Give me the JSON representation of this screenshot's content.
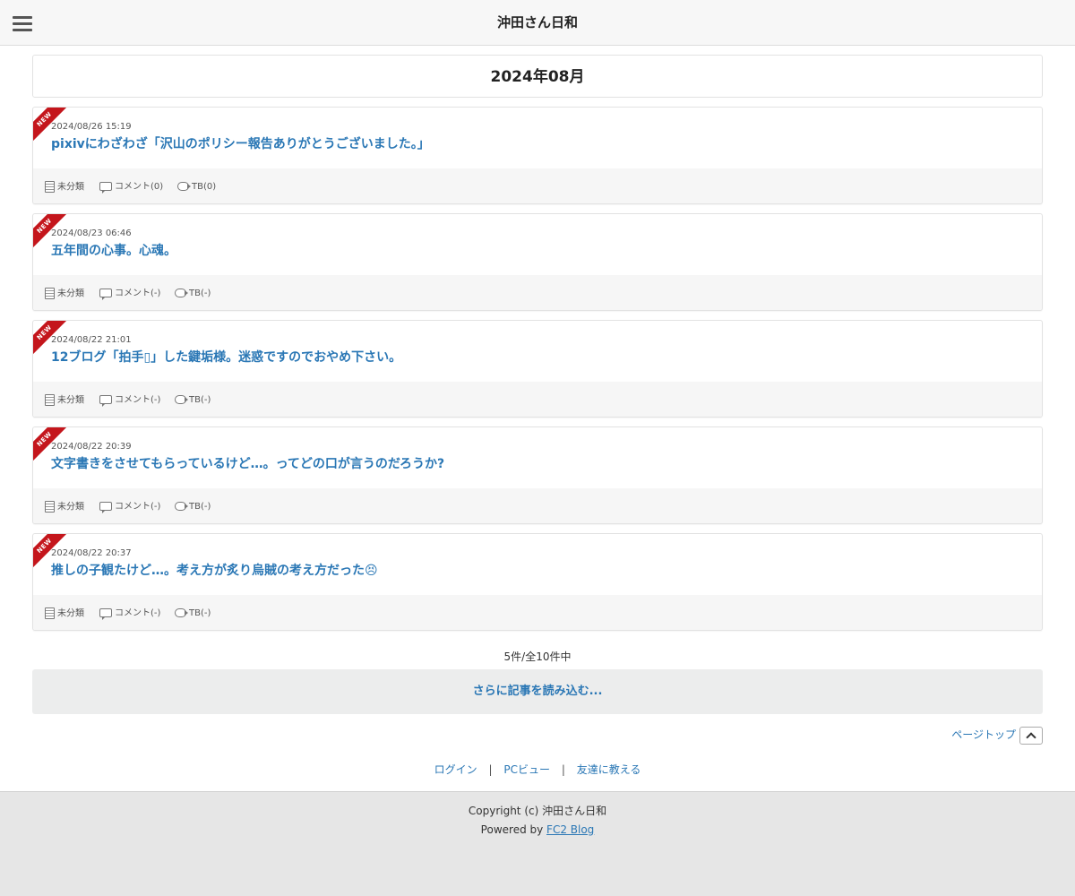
{
  "header": {
    "title": "沖田さん日和",
    "menu_icon": "hamburger-menu-icon"
  },
  "month": {
    "label": "2024年08月"
  },
  "entries": [
    {
      "badge": "NEW",
      "date": "2024/08/26 15:19",
      "title": "pixivにわざわざ「沢山のポリシー報告ありがとうございました。」",
      "category": "未分類",
      "comment": "コメント(0)",
      "tb": "TB(0)"
    },
    {
      "badge": "NEW",
      "date": "2024/08/23 06:46",
      "title": "五年間の心事。心魂。",
      "category": "未分類",
      "comment": "コメント(-)",
      "tb": "TB(-)"
    },
    {
      "badge": "NEW",
      "date": "2024/08/22 21:01",
      "title": "12ブログ「拍手▯」した鍵垢様。迷惑ですのでおやめ下さい。",
      "category": "未分類",
      "comment": "コメント(-)",
      "tb": "TB(-)"
    },
    {
      "badge": "NEW",
      "date": "2024/08/22 20:39",
      "title": "文字書きをさせてもらっているけど…。ってどの口が言うのだろうか?",
      "category": "未分類",
      "comment": "コメント(-)",
      "tb": "TB(-)"
    },
    {
      "badge": "NEW",
      "date": "2024/08/22 20:37",
      "title": "推しの子観たけど…。考え方が炙り烏賊の考え方だった😣",
      "category": "未分類",
      "comment": "コメント(-)",
      "tb": "TB(-)"
    }
  ],
  "pagination": {
    "count_text": "5件/全10件中",
    "load_more": "さらに記事を読み込む..."
  },
  "page_top": {
    "label": "ページトップ"
  },
  "footer_links": {
    "login": "ログイン",
    "pc_view": "PCビュー",
    "tell_friend": "友達に教える",
    "separator": "|"
  },
  "footer": {
    "copyright": "Copyright (c) 沖田さん日和",
    "powered_prefix": "Powered by ",
    "powered_link": "FC2 Blog"
  },
  "colors": {
    "link": "#2a77b5",
    "ribbon": "#c4161c",
    "header_bg": "#f7f7f7",
    "footer_bg": "#e6e6e6"
  }
}
